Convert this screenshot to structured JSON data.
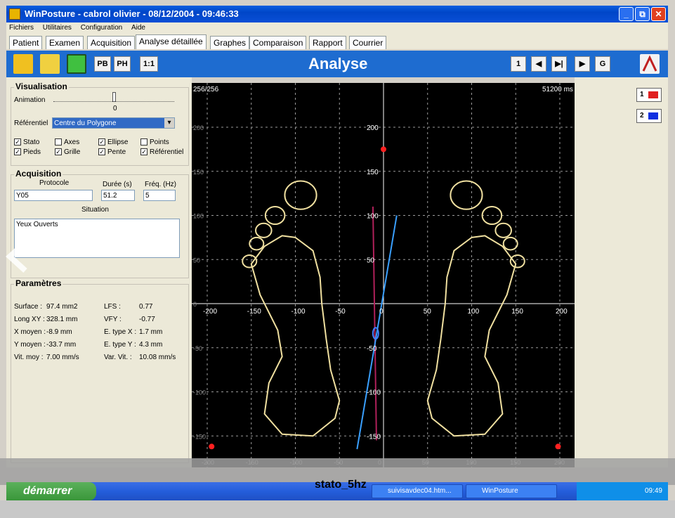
{
  "window": {
    "title": "WinPosture - cabrol olivier - 08/12/2004 - 09:46:33",
    "minimize": "_",
    "maximize": "⧉",
    "close": "✕"
  },
  "menu": [
    "Fichiers",
    "Utilitaires",
    "Configuration",
    "Aide"
  ],
  "tabs": [
    "Patient",
    "Examen",
    "Acquisition",
    "Analyse détaillée",
    "Graphes",
    "Comparaison",
    "Rapport",
    "Courrier"
  ],
  "toolbar": {
    "title": "Analyse",
    "pb": "PB",
    "ph": "PH",
    "ratio": "1:1",
    "nav": [
      "1",
      "◀",
      "▶|",
      "▶",
      "G"
    ]
  },
  "visualisation": {
    "title": "Visualisation",
    "animation_label": "Animation",
    "animation_value": "0",
    "referentiel_label": "Référentiel",
    "referentiel_value": "Centre du Polygone",
    "checkboxes": [
      {
        "label": "Stato",
        "checked": true
      },
      {
        "label": "Axes",
        "checked": false
      },
      {
        "label": "Ellipse",
        "checked": true
      },
      {
        "label": "Points",
        "checked": false
      },
      {
        "label": "Pieds",
        "checked": true
      },
      {
        "label": "Grille",
        "checked": true
      },
      {
        "label": "Pente",
        "checked": true
      },
      {
        "label": "Référentiel",
        "checked": true
      }
    ]
  },
  "acquisition": {
    "title": "Acquisition",
    "protocole_label": "Protocole",
    "protocole": "Y05",
    "duree_label": "Durée (s)",
    "duree": "51.2",
    "freq_label": "Fréq. (Hz)",
    "freq": "5",
    "situation_label": "Situation",
    "situation": "Yeux Ouverts"
  },
  "parametres": {
    "title": "Paramètres",
    "left": [
      {
        "k": "Surface :",
        "v": "97.4 mm2"
      },
      {
        "k": "Long XY :",
        "v": "328.1 mm"
      },
      {
        "k": "X moyen :",
        "v": "-8.9 mm"
      },
      {
        "k": "Y moyen :",
        "v": "-33.7 mm"
      },
      {
        "k": "Vit. moy :",
        "v": "7.00 mm/s"
      }
    ],
    "right": [
      {
        "k": "LFS :",
        "v": "0.77"
      },
      {
        "k": "VFY :",
        "v": "-0.77"
      },
      {
        "k": "E. type X :",
        "v": "1.7 mm"
      },
      {
        "k": "E. type Y :",
        "v": "4.3 mm"
      },
      {
        "k": "Var. Vit. :",
        "v": "10.08 mm/s"
      }
    ]
  },
  "plot": {
    "counter": "256/256",
    "time": "51200 ms",
    "xticks": [
      "-200",
      "-150",
      "-100",
      "-50",
      "0",
      "50",
      "100",
      "150",
      "200"
    ],
    "yticks": [
      "200",
      "150",
      "100",
      "50",
      "-50",
      "-100",
      "-150"
    ],
    "grid_left_labels": [
      "200",
      "150",
      "100",
      "50",
      "0",
      "-50",
      "-100",
      "-150",
      "-200"
    ],
    "grid_bottom_labels": [
      "-200",
      "-150",
      "-100",
      "-50",
      "0",
      "50",
      "100",
      "150",
      "200"
    ],
    "colors": {
      "foot": "#f0e0a0",
      "grid": "#9a9a9a",
      "axis": "#ffffff",
      "pente": "#3aa0ff",
      "stato": "#b0205a",
      "ellipse": "#4080ff",
      "marker": "#ff2020"
    },
    "mean_x": -8.9,
    "mean_y": -33.7
  },
  "channels": [
    {
      "label": "1",
      "color": "#e02020"
    },
    {
      "label": "2",
      "color": "#1030e0"
    }
  ],
  "taskbar": {
    "start": "démarrer",
    "tasks": [
      "suivisavdec04.htm...",
      "WinPosture"
    ],
    "clock": "09:49"
  },
  "caption": "stato_5hz"
}
